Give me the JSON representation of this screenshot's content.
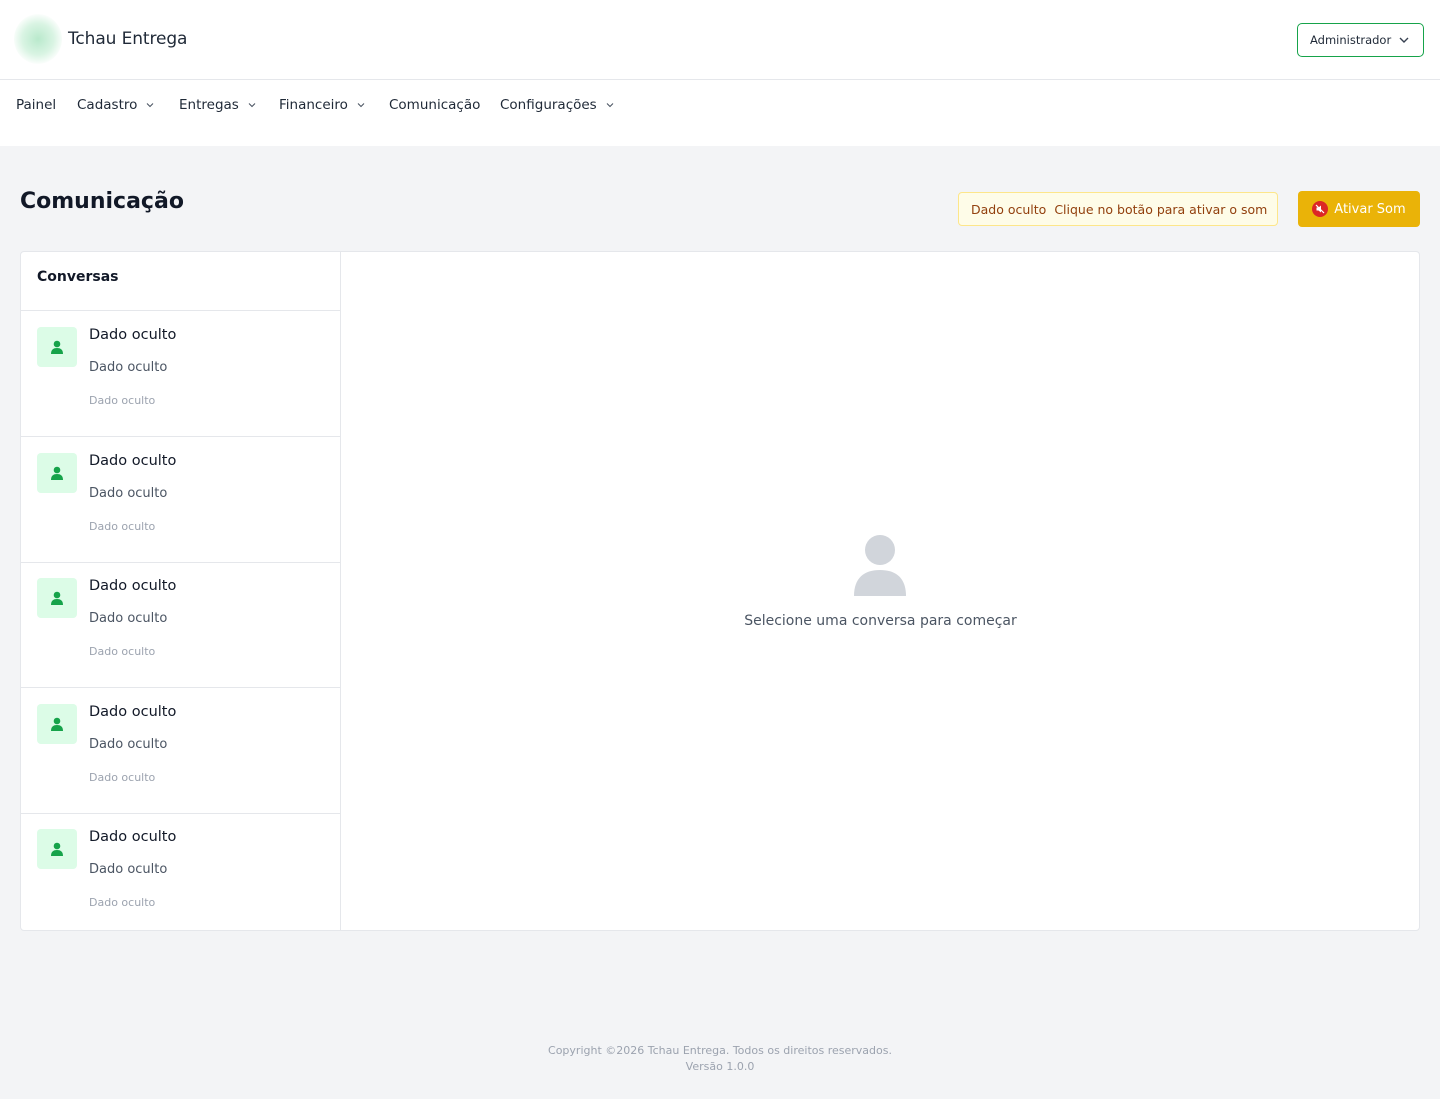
{
  "header": {
    "brand": "Tchau Entrega",
    "user_menu_label": "Administrador"
  },
  "nav": {
    "items": [
      {
        "label": "Painel",
        "has_dropdown": false
      },
      {
        "label": "Cadastro",
        "has_dropdown": true
      },
      {
        "label": "Entregas",
        "has_dropdown": true
      },
      {
        "label": "Financeiro",
        "has_dropdown": true
      },
      {
        "label": "Comunicação",
        "has_dropdown": false
      },
      {
        "label": "Configurações",
        "has_dropdown": true
      }
    ]
  },
  "page": {
    "title": "Comunicação",
    "sound_notice": {
      "hidden_label": "Dado oculto",
      "message": "Clique no botão para ativar o som"
    },
    "sound_button_label": "Ativar Som"
  },
  "conversations": {
    "header": "Conversas",
    "items": [
      {
        "name": "Dado oculto",
        "message": "Dado oculto",
        "time": "Dado oculto"
      },
      {
        "name": "Dado oculto",
        "message": "Dado oculto",
        "time": "Dado oculto"
      },
      {
        "name": "Dado oculto",
        "message": "Dado oculto",
        "time": "Dado oculto"
      },
      {
        "name": "Dado oculto",
        "message": "Dado oculto",
        "time": "Dado oculto"
      },
      {
        "name": "Dado oculto",
        "message": "Dado oculto",
        "time": "Dado oculto"
      }
    ]
  },
  "empty_state": {
    "icon": "user-silhouette-icon",
    "text": "Selecione uma conversa para começar"
  },
  "footer": {
    "copyright": "Copyright ©2026 Tchau Entrega. Todos os direitos reservados.",
    "version": "Versão 1.0.0"
  },
  "colors": {
    "accent_green": "#16a34a",
    "avatar_bg": "#dcfce7",
    "warning_yellow": "#eab308",
    "notice_bg": "#fefce8",
    "page_bg": "#f3f4f6"
  }
}
